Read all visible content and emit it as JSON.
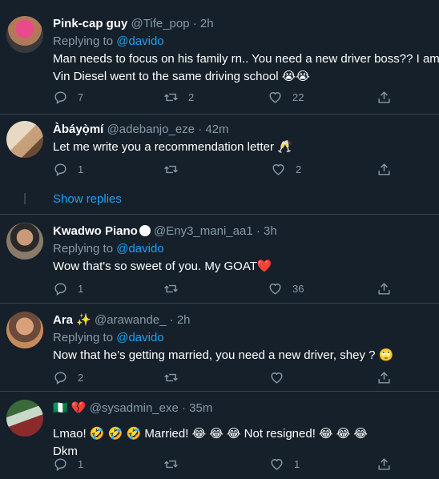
{
  "tweets": [
    {
      "name": "Pink-cap guy",
      "handle": "@Tife_pop",
      "time": "· 2h",
      "replying_prefix": "Replying to ",
      "replying_to": "@davido",
      "text_lines": [
        "Man needs to focus on his family rn.. You need a new driver boss?? I am",
        "Vin Diesel went to the same driving school 😭😭"
      ],
      "replies": "7",
      "retweets": "2",
      "likes": "22"
    },
    {
      "name": "Àbáyọ̀mí",
      "handle": "@adebanjo_eze",
      "time": "· 42m",
      "text_lines": [
        "Let me write you a recommendation letter 🥂"
      ],
      "replies": "1",
      "retweets": "",
      "likes": "2"
    },
    {
      "name": "Kwadwo Piano",
      "handle": "@Eny3_mani_aa1",
      "time": "· 3h",
      "replying_prefix": "Replying to ",
      "replying_to": "@davido",
      "text_lines": [
        "Wow that's so sweet of you. My GOAT❤️"
      ],
      "replies": "1",
      "retweets": "",
      "likes": "36"
    },
    {
      "name": "Ara ✨",
      "handle": "@arawande_",
      "time": "· 2h",
      "replying_prefix": "Replying to ",
      "replying_to": "@davido",
      "text_lines": [
        "Now that he’s getting married, you need a new driver, shey ? 🙄"
      ],
      "replies": "2",
      "retweets": "",
      "likes": ""
    },
    {
      "name": "🇳🇬 💔",
      "handle": "@sysadmin_exe",
      "time": "· 35m",
      "text_lines": [
        "Lmao! 🤣 🤣 🤣 Married! 😂 😂 😂 Not resigned! 😂 😂 😂",
        "Dkm"
      ],
      "replies": "1",
      "retweets": "",
      "likes": "1"
    }
  ],
  "show_replies": "Show replies",
  "colors": {
    "background": "#15202b",
    "accent": "#1da1f2",
    "muted": "#8899a6",
    "divider": "#38444d"
  }
}
